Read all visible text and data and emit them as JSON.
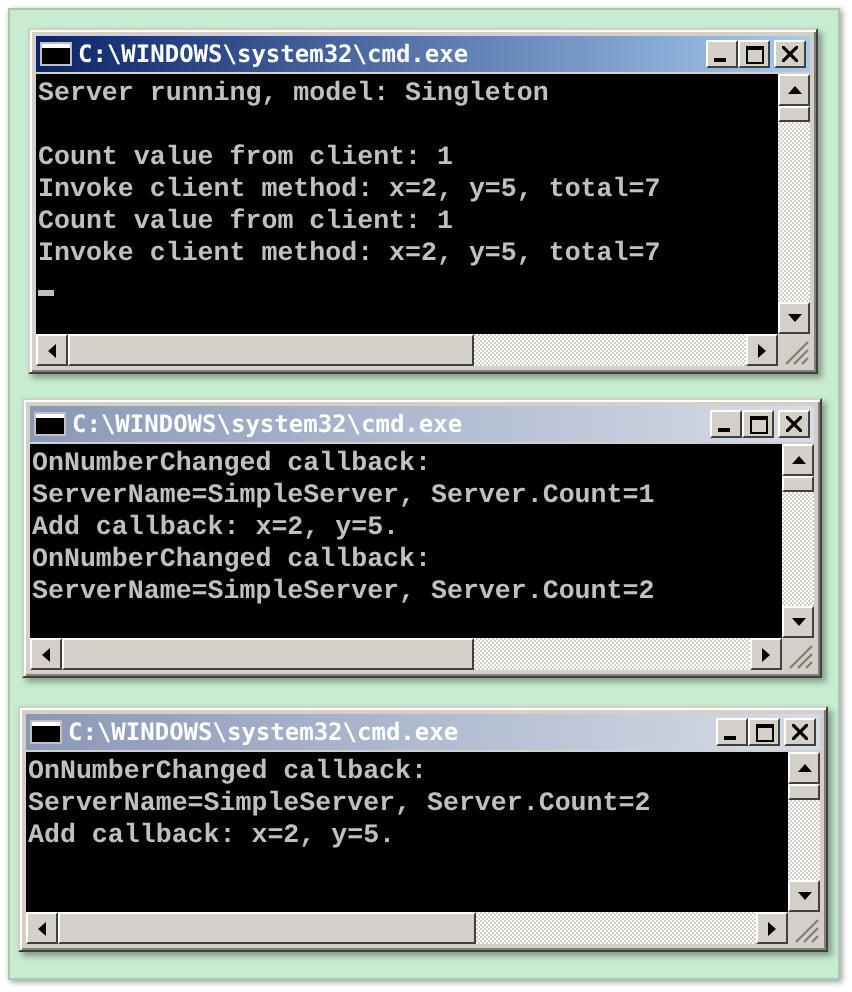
{
  "windows": [
    {
      "title": "C:\\WINDOWS\\system32\\cmd.exe",
      "active": true,
      "cursor": true,
      "lines": [
        {
          "kind": "text",
          "text": "Server running, model: Singleton"
        },
        {
          "kind": "blank"
        },
        {
          "kind": "text",
          "text": "Count value from client: 1"
        },
        {
          "kind": "text",
          "text": "Invoke client method: x=2, y=5, total=7"
        },
        {
          "kind": "text",
          "text": "Count value from client: 1"
        },
        {
          "kind": "text",
          "text": "Invoke client method: x=2, y=5, total=7"
        }
      ]
    },
    {
      "title": "C:\\WINDOWS\\system32\\cmd.exe",
      "active": false,
      "cursor": false,
      "lines": [
        {
          "kind": "text",
          "text": "OnNumberChanged callback:"
        },
        {
          "kind": "text",
          "text": "ServerName=SimpleServer, Server.Count=1"
        },
        {
          "kind": "text",
          "text": "Add callback: x=2, y=5."
        },
        {
          "kind": "text",
          "text": "OnNumberChanged callback:"
        },
        {
          "kind": "text",
          "text": "ServerName=SimpleServer, Server.Count=2"
        }
      ]
    },
    {
      "title": "C:\\WINDOWS\\system32\\cmd.exe",
      "active": false,
      "cursor": false,
      "lines": [
        {
          "kind": "text",
          "text": "OnNumberChanged callback:"
        },
        {
          "kind": "text",
          "text": "ServerName=SimpleServer, Server.Count=2"
        },
        {
          "kind": "text",
          "text": "Add callback: x=2, y=5."
        }
      ]
    }
  ]
}
